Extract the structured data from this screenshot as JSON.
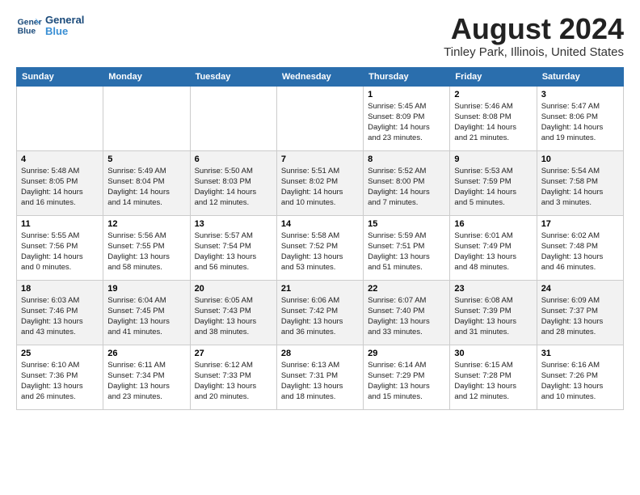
{
  "logo": {
    "line1": "General",
    "line2": "Blue"
  },
  "title": "August 2024",
  "location": "Tinley Park, Illinois, United States",
  "days_of_week": [
    "Sunday",
    "Monday",
    "Tuesday",
    "Wednesday",
    "Thursday",
    "Friday",
    "Saturday"
  ],
  "weeks": [
    [
      {
        "day": "",
        "info": ""
      },
      {
        "day": "",
        "info": ""
      },
      {
        "day": "",
        "info": ""
      },
      {
        "day": "",
        "info": ""
      },
      {
        "day": "1",
        "info": "Sunrise: 5:45 AM\nSunset: 8:09 PM\nDaylight: 14 hours\nand 23 minutes."
      },
      {
        "day": "2",
        "info": "Sunrise: 5:46 AM\nSunset: 8:08 PM\nDaylight: 14 hours\nand 21 minutes."
      },
      {
        "day": "3",
        "info": "Sunrise: 5:47 AM\nSunset: 8:06 PM\nDaylight: 14 hours\nand 19 minutes."
      }
    ],
    [
      {
        "day": "4",
        "info": "Sunrise: 5:48 AM\nSunset: 8:05 PM\nDaylight: 14 hours\nand 16 minutes."
      },
      {
        "day": "5",
        "info": "Sunrise: 5:49 AM\nSunset: 8:04 PM\nDaylight: 14 hours\nand 14 minutes."
      },
      {
        "day": "6",
        "info": "Sunrise: 5:50 AM\nSunset: 8:03 PM\nDaylight: 14 hours\nand 12 minutes."
      },
      {
        "day": "7",
        "info": "Sunrise: 5:51 AM\nSunset: 8:02 PM\nDaylight: 14 hours\nand 10 minutes."
      },
      {
        "day": "8",
        "info": "Sunrise: 5:52 AM\nSunset: 8:00 PM\nDaylight: 14 hours\nand 7 minutes."
      },
      {
        "day": "9",
        "info": "Sunrise: 5:53 AM\nSunset: 7:59 PM\nDaylight: 14 hours\nand 5 minutes."
      },
      {
        "day": "10",
        "info": "Sunrise: 5:54 AM\nSunset: 7:58 PM\nDaylight: 14 hours\nand 3 minutes."
      }
    ],
    [
      {
        "day": "11",
        "info": "Sunrise: 5:55 AM\nSunset: 7:56 PM\nDaylight: 14 hours\nand 0 minutes."
      },
      {
        "day": "12",
        "info": "Sunrise: 5:56 AM\nSunset: 7:55 PM\nDaylight: 13 hours\nand 58 minutes."
      },
      {
        "day": "13",
        "info": "Sunrise: 5:57 AM\nSunset: 7:54 PM\nDaylight: 13 hours\nand 56 minutes."
      },
      {
        "day": "14",
        "info": "Sunrise: 5:58 AM\nSunset: 7:52 PM\nDaylight: 13 hours\nand 53 minutes."
      },
      {
        "day": "15",
        "info": "Sunrise: 5:59 AM\nSunset: 7:51 PM\nDaylight: 13 hours\nand 51 minutes."
      },
      {
        "day": "16",
        "info": "Sunrise: 6:01 AM\nSunset: 7:49 PM\nDaylight: 13 hours\nand 48 minutes."
      },
      {
        "day": "17",
        "info": "Sunrise: 6:02 AM\nSunset: 7:48 PM\nDaylight: 13 hours\nand 46 minutes."
      }
    ],
    [
      {
        "day": "18",
        "info": "Sunrise: 6:03 AM\nSunset: 7:46 PM\nDaylight: 13 hours\nand 43 minutes."
      },
      {
        "day": "19",
        "info": "Sunrise: 6:04 AM\nSunset: 7:45 PM\nDaylight: 13 hours\nand 41 minutes."
      },
      {
        "day": "20",
        "info": "Sunrise: 6:05 AM\nSunset: 7:43 PM\nDaylight: 13 hours\nand 38 minutes."
      },
      {
        "day": "21",
        "info": "Sunrise: 6:06 AM\nSunset: 7:42 PM\nDaylight: 13 hours\nand 36 minutes."
      },
      {
        "day": "22",
        "info": "Sunrise: 6:07 AM\nSunset: 7:40 PM\nDaylight: 13 hours\nand 33 minutes."
      },
      {
        "day": "23",
        "info": "Sunrise: 6:08 AM\nSunset: 7:39 PM\nDaylight: 13 hours\nand 31 minutes."
      },
      {
        "day": "24",
        "info": "Sunrise: 6:09 AM\nSunset: 7:37 PM\nDaylight: 13 hours\nand 28 minutes."
      }
    ],
    [
      {
        "day": "25",
        "info": "Sunrise: 6:10 AM\nSunset: 7:36 PM\nDaylight: 13 hours\nand 26 minutes."
      },
      {
        "day": "26",
        "info": "Sunrise: 6:11 AM\nSunset: 7:34 PM\nDaylight: 13 hours\nand 23 minutes."
      },
      {
        "day": "27",
        "info": "Sunrise: 6:12 AM\nSunset: 7:33 PM\nDaylight: 13 hours\nand 20 minutes."
      },
      {
        "day": "28",
        "info": "Sunrise: 6:13 AM\nSunset: 7:31 PM\nDaylight: 13 hours\nand 18 minutes."
      },
      {
        "day": "29",
        "info": "Sunrise: 6:14 AM\nSunset: 7:29 PM\nDaylight: 13 hours\nand 15 minutes."
      },
      {
        "day": "30",
        "info": "Sunrise: 6:15 AM\nSunset: 7:28 PM\nDaylight: 13 hours\nand 12 minutes."
      },
      {
        "day": "31",
        "info": "Sunrise: 6:16 AM\nSunset: 7:26 PM\nDaylight: 13 hours\nand 10 minutes."
      }
    ]
  ]
}
